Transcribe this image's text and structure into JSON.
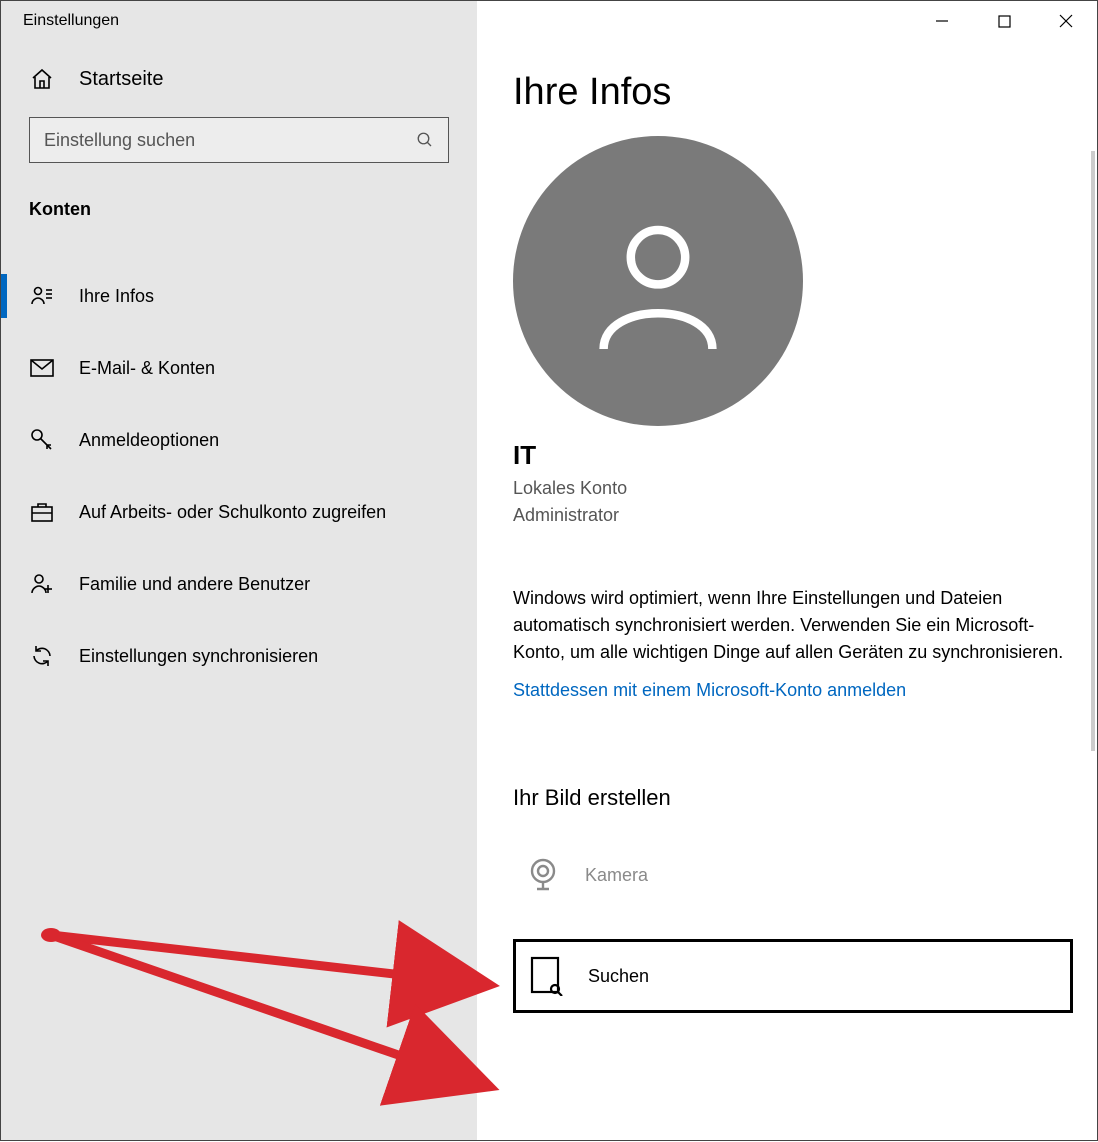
{
  "window": {
    "title": "Einstellungen"
  },
  "sidebar": {
    "home_label": "Startseite",
    "search_placeholder": "Einstellung suchen",
    "section_header": "Konten",
    "items": [
      {
        "icon": "person-info-icon",
        "label": "Ihre Infos",
        "active": true
      },
      {
        "icon": "mail-icon",
        "label": "E-Mail- & Konten",
        "active": false
      },
      {
        "icon": "key-icon",
        "label": "Anmeldeoptionen",
        "active": false
      },
      {
        "icon": "briefcase-icon",
        "label": "Auf Arbeits- oder Schulkonto zugreifen",
        "active": false
      },
      {
        "icon": "family-icon",
        "label": "Familie und andere Benutzer",
        "active": false
      },
      {
        "icon": "sync-icon",
        "label": "Einstellungen synchronisieren",
        "active": false
      }
    ]
  },
  "main": {
    "title": "Ihre Infos",
    "user_name": "IT",
    "account_type": "Lokales Konto",
    "role": "Administrator",
    "optimization_text": "Windows wird optimiert, wenn Ihre Einstellungen und Dateien automatisch synchronisiert werden. Verwenden Sie ein Microsoft-Konto, um alle wichtigen Dinge auf allen Geräten zu synchronisieren.",
    "ms_link": "Stattdessen mit einem Microsoft-Konto anmelden",
    "create_picture_header": "Ihr Bild erstellen",
    "camera_label": "Kamera",
    "browse_label": "Suchen"
  }
}
